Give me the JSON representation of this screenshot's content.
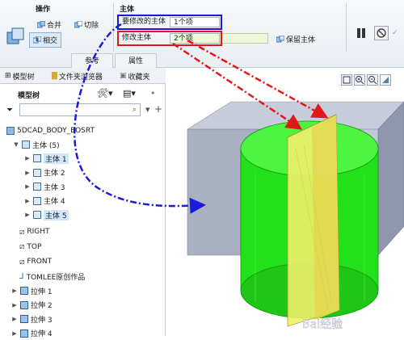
{
  "ribbon": {
    "operations_label": "操作",
    "merge_label": "合并",
    "cut_label": "切除",
    "intersect_label": "相交",
    "body_label": "主体",
    "body_to_modify_label": "要修改的主体",
    "body_to_modify_value": "1个项",
    "modify_body_label": "修改主体",
    "modify_body_value": "2个项",
    "keep_body_label": "保留主体",
    "tab_reference": "参考",
    "tab_properties": "属性",
    "pause_icon": "pause-icon",
    "stop_icon": "no-entry-icon"
  },
  "panel": {
    "tab_model_tree": "模型树",
    "tab_file_browser": "文件夹浏览器",
    "tab_favorites": "收藏夹",
    "tree_title": "模型树",
    "search_placeholder": ""
  },
  "tree": {
    "root": "5DCAD_BODY_BOSRT",
    "bodies_group": "主体 (5)",
    "bodies": [
      "主体 1",
      "主体 2",
      "主体 3",
      "主体 4",
      "主体 5"
    ],
    "datums": [
      "RIGHT",
      "TOP",
      "FRONT"
    ],
    "csys": "TOMLEE原创作品",
    "extrudes": [
      "拉伸 1",
      "拉伸 2",
      "拉伸 3",
      "拉伸 4"
    ]
  },
  "watermark": "Bai经验",
  "colors": {
    "blue_box": "#1a1adc",
    "red_box": "#e01818",
    "green_body": "#22e01a",
    "yellow_body": "#f0f06a",
    "slate_block": "#9aa3b8"
  }
}
